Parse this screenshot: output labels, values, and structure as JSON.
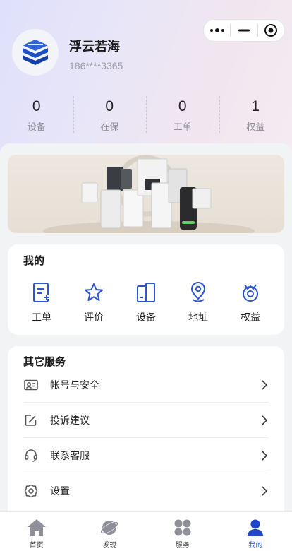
{
  "profile": {
    "name": "浮云若海",
    "phone": "186****3365"
  },
  "stats": [
    {
      "value": "0",
      "label": "设备"
    },
    {
      "value": "0",
      "label": "在保"
    },
    {
      "value": "0",
      "label": "工单"
    },
    {
      "value": "1",
      "label": "权益"
    }
  ],
  "mine": {
    "title": "我的",
    "items": [
      {
        "label": "工单",
        "icon": "work-order-icon"
      },
      {
        "label": "评价",
        "icon": "star-icon"
      },
      {
        "label": "设备",
        "icon": "device-icon"
      },
      {
        "label": "地址",
        "icon": "location-icon"
      },
      {
        "label": "权益",
        "icon": "badge-icon"
      }
    ]
  },
  "services": {
    "title": "其它服务",
    "items": [
      {
        "label": "帐号与安全",
        "icon": "id-card-icon"
      },
      {
        "label": "投诉建议",
        "icon": "edit-icon"
      },
      {
        "label": "联系客服",
        "icon": "headset-icon"
      },
      {
        "label": "设置",
        "icon": "gear-icon"
      }
    ]
  },
  "tabs": [
    {
      "label": "首页",
      "icon": "home-icon",
      "active": false
    },
    {
      "label": "发现",
      "icon": "planet-icon",
      "active": false
    },
    {
      "label": "服务",
      "icon": "grid-icon",
      "active": false
    },
    {
      "label": "我的",
      "icon": "user-icon",
      "active": true
    }
  ],
  "colors": {
    "accent": "#2b55d4",
    "icon_gray": "#8f9099",
    "hero_start": "#dfe0fb",
    "hero_end": "#f4ecf2"
  }
}
